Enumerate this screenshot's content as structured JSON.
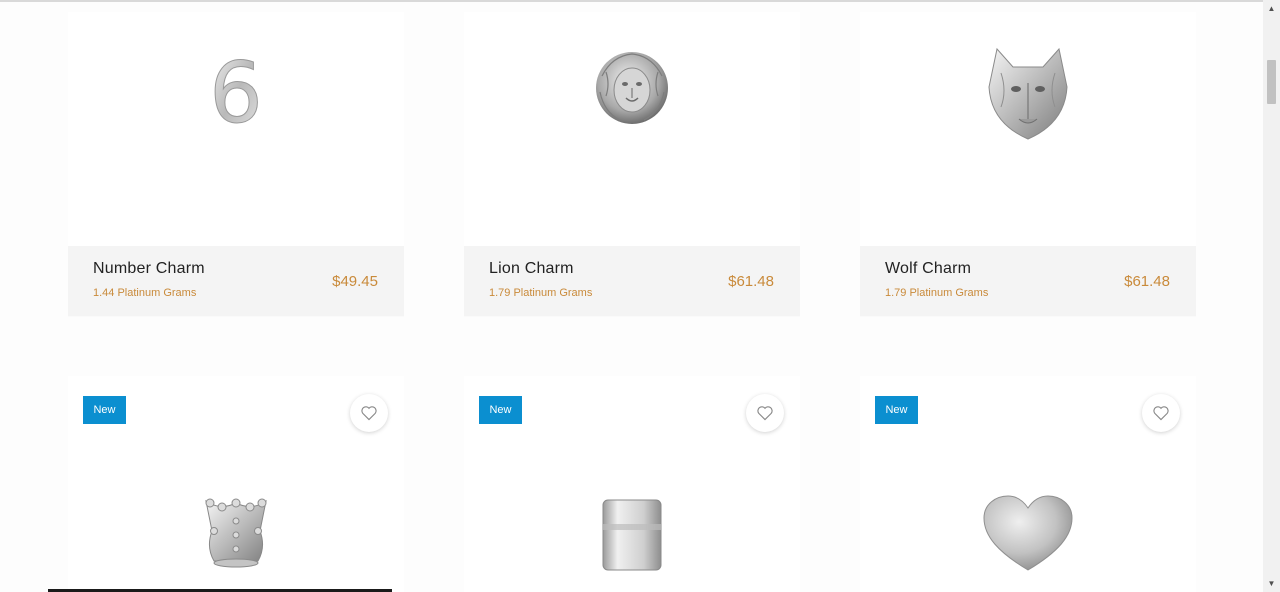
{
  "products_row1": [
    {
      "name": "Number Charm",
      "weight": "1.44 Platinum Grams",
      "price": "$49.45",
      "icon": "number-six-charm"
    },
    {
      "name": "Lion Charm",
      "weight": "1.79 Platinum Grams",
      "price": "$61.48",
      "icon": "lion-head-charm"
    },
    {
      "name": "Wolf Charm",
      "weight": "1.79 Platinum Grams",
      "price": "$61.48",
      "icon": "wolf-head-charm"
    }
  ],
  "products_row2": [
    {
      "badge": "New",
      "icon": "crown-charm"
    },
    {
      "badge": "New",
      "icon": "square-bead-charm"
    },
    {
      "badge": "New",
      "icon": "heart-charm"
    }
  ],
  "number_glyph": "6",
  "colors": {
    "accent_gold": "#c98a3a",
    "badge_blue": "#0b8fd0",
    "card_bg": "#f4f4f4"
  }
}
